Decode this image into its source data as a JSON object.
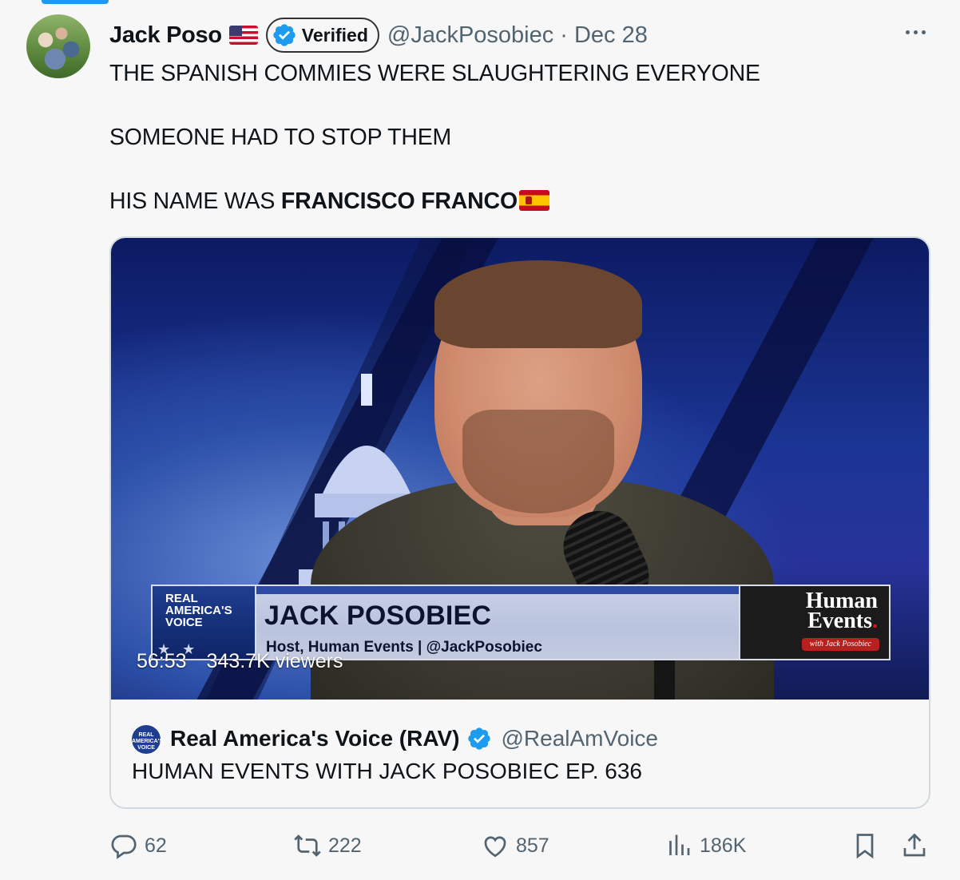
{
  "tweet": {
    "author_name": "Jack Poso",
    "author_flag": "us-flag",
    "verified_label": "Verified",
    "handle": "@JackPosobiec",
    "separator": "·",
    "date": "Dec 28",
    "text_line_1": "THE SPANISH COMMIES WERE SLAUGHTERING EVERYONE",
    "text_line_2": "SOMEONE HAD TO STOP THEM",
    "text_line_3_plain": "HIS NAME WAS ",
    "text_line_3_bold": "FRANCISCO FRANCO",
    "text_line_3_flag": "spain-flag"
  },
  "video": {
    "lower_third_logo": "REAL AMERICA'S VOICE",
    "lower_third_logo_line1": "REAL",
    "lower_third_logo_line2": "AMERICA'S",
    "lower_third_logo_line3": "VOICE",
    "lower_third_name": "JACK POSOBIEC",
    "lower_third_subtitle": "Host, Human Events | @JackPosobiec",
    "show_logo_line1": "Human",
    "show_logo_line2": "Events",
    "show_logo_tag": "with Jack Posobiec",
    "duration": "56:53",
    "viewers": "343.7K viewers"
  },
  "quoted": {
    "avatar_text": "REAL AMERICA'S VOICE",
    "name": "Real America's Voice (RAV)",
    "handle": "@RealAmVoice",
    "text": "HUMAN EVENTS WITH JACK POSOBIEC EP. 636"
  },
  "actions": {
    "replies": "62",
    "reposts": "222",
    "likes": "857",
    "views": "186K"
  },
  "colors": {
    "verified_blue": "#1d9bf0",
    "secondary_text": "#536471",
    "primary_text": "#0f1419",
    "border": "#cfd9de"
  },
  "icons": [
    "more-icon",
    "verified-badge-icon",
    "reply-icon",
    "repost-icon",
    "like-icon",
    "views-icon",
    "bookmark-icon",
    "share-icon"
  ]
}
